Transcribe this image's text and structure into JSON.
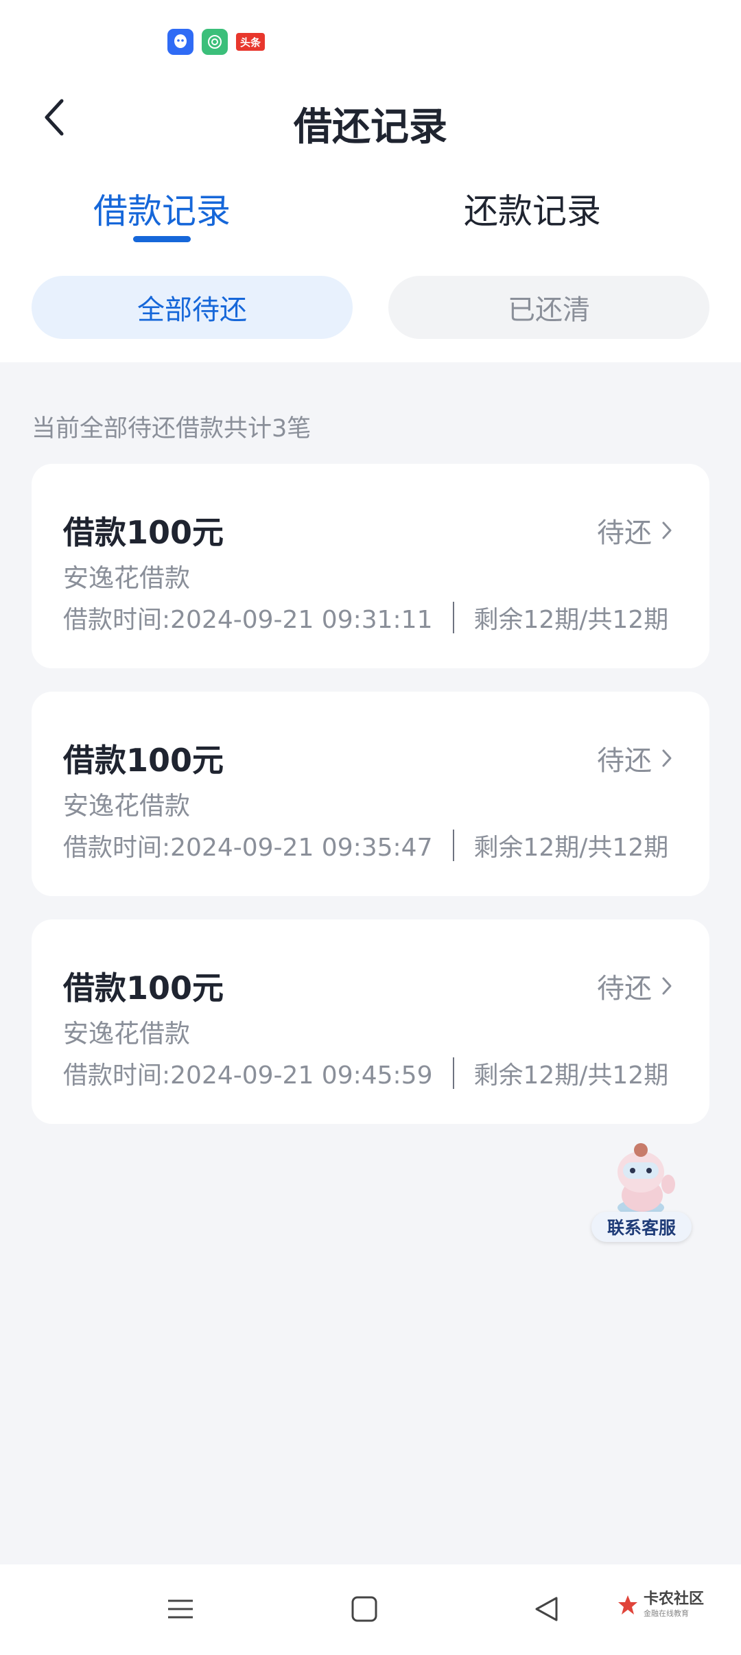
{
  "status_bar": {
    "icons": [
      "qq-icon",
      "green-app-icon",
      "toutiao-icon"
    ],
    "toutiao_label": "头条"
  },
  "header": {
    "title": "借还记录",
    "back_icon": "chevron-left-icon"
  },
  "tabs": [
    {
      "label": "借款记录",
      "active": true
    },
    {
      "label": "还款记录",
      "active": false
    }
  ],
  "filters": [
    {
      "label": "全部待还",
      "active": true
    },
    {
      "label": "已还清",
      "active": false
    }
  ],
  "summary": "当前全部待还借款共计3笔",
  "loans": [
    {
      "amount": "借款100元",
      "status": "待还",
      "product": "安逸花借款",
      "time": "借款时间:2024-09-21 09:31:11",
      "periods": "剩余12期/共12期"
    },
    {
      "amount": "借款100元",
      "status": "待还",
      "product": "安逸花借款",
      "time": "借款时间:2024-09-21 09:35:47",
      "periods": "剩余12期/共12期"
    },
    {
      "amount": "借款100元",
      "status": "待还",
      "product": "安逸花借款",
      "time": "借款时间:2024-09-21 09:45:59",
      "periods": "剩余12期/共12期"
    }
  ],
  "customer_service": {
    "label": "联系客服"
  },
  "nav": {
    "menu_icon": "menu-icon",
    "home_icon": "home-square-icon",
    "back_icon": "back-triangle-icon"
  },
  "watermark": {
    "main": "卡农社区",
    "sub": "金融在线教育"
  },
  "colors": {
    "accent": "#1667d9",
    "background": "#f4f5f8",
    "muted_text": "#8a8f99"
  }
}
